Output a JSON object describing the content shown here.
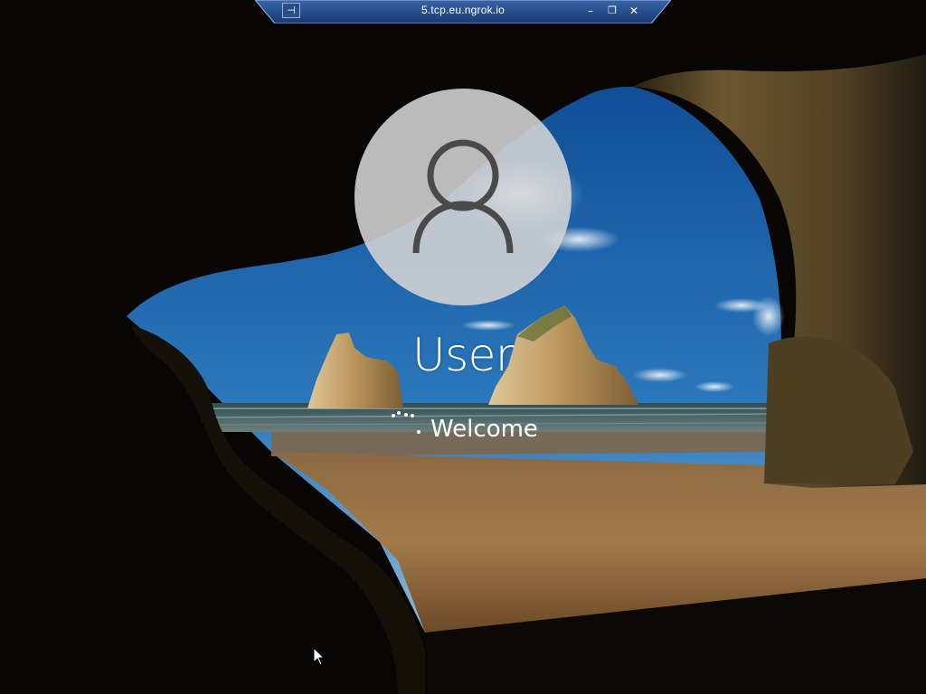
{
  "remote_session": {
    "connection_title": "5.tcp.eu.ngrok.io",
    "pin_icon": "pin-icon",
    "minimize_icon": "minimize-icon",
    "minimize_glyph": "–",
    "restore_icon": "restore-icon",
    "restore_glyph": "❐",
    "close_icon": "close-icon",
    "close_glyph": "✕",
    "bar_color": "#1c3f7a"
  },
  "lock_screen": {
    "avatar_icon": "user-silhouette-icon",
    "username": "User",
    "status_text": "Welcome",
    "spinner_icon": "loading-dots-icon"
  },
  "pointer": {
    "icon": "mouse-cursor-icon"
  }
}
